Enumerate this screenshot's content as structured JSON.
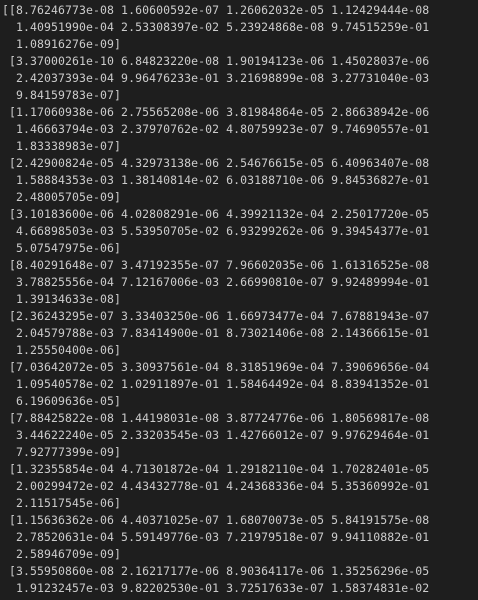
{
  "output": {
    "lines": [
      "[[8.76246773e-08 1.60600592e-07 1.26062032e-05 1.12429444e-08",
      "  1.40951990e-04 2.53308397e-02 5.23924868e-08 9.74515259e-01",
      "  1.08916276e-09]",
      " [3.37000261e-10 6.84823220e-08 1.90194123e-06 1.45028037e-06",
      "  2.42037393e-04 9.96476233e-01 3.21698899e-08 3.27731040e-03",
      "  9.84159783e-07]",
      " [1.17060938e-06 2.75565208e-06 3.81984864e-05 2.86638942e-06",
      "  1.46663794e-03 2.37970762e-02 4.80759923e-07 9.74690557e-01",
      "  1.83338983e-07]",
      " [2.42900824e-05 4.32973138e-06 2.54676615e-05 6.40963407e-08",
      "  1.58884353e-03 1.38140814e-02 6.03188710e-06 9.84536827e-01",
      "  2.48005705e-09]",
      " [3.10183600e-06 4.02808291e-06 4.39921132e-04 2.25017720e-05",
      "  4.66898503e-03 5.53950705e-02 6.93299262e-06 9.39454377e-01",
      "  5.07547975e-06]",
      " [8.40291648e-07 3.47192355e-07 7.96602035e-06 1.61316525e-08",
      "  3.78825556e-04 7.12167006e-03 2.66990810e-07 9.92489994e-01",
      "  1.39134633e-08]",
      " [2.36243295e-07 3.33403250e-06 1.66973477e-04 7.67881943e-07",
      "  2.04579788e-03 7.83414900e-01 8.73021406e-08 2.14366615e-01",
      "  1.25550400e-06]",
      " [7.03642072e-05 3.30937561e-04 8.31851969e-04 7.39069656e-04",
      "  1.09540578e-02 1.02911897e-01 1.58464492e-04 8.83941352e-01",
      "  6.19609636e-05]",
      " [7.88425822e-08 1.44198031e-08 3.87724776e-06 1.80569817e-08",
      "  3.44622240e-05 2.33203545e-03 1.42766012e-07 9.97629464e-01",
      "  7.92777399e-09]",
      " [1.32355854e-04 4.71301872e-04 1.29182110e-04 1.70282401e-05",
      "  2.00299472e-02 4.43432778e-01 4.24368336e-04 5.35360992e-01",
      "  2.11517545e-06]",
      " [1.15636362e-06 4.40371025e-07 1.68070073e-05 5.84191575e-08",
      "  2.78520631e-04 5.59149776e-03 7.21979518e-07 9.94110882e-01",
      "  2.58946709e-09]",
      " [3.55950860e-08 2.16217177e-06 8.90364117e-06 1.35256296e-05",
      "  1.91232457e-03 9.82202530e-01 3.72517633e-07 1.58374831e-02"
    ]
  }
}
